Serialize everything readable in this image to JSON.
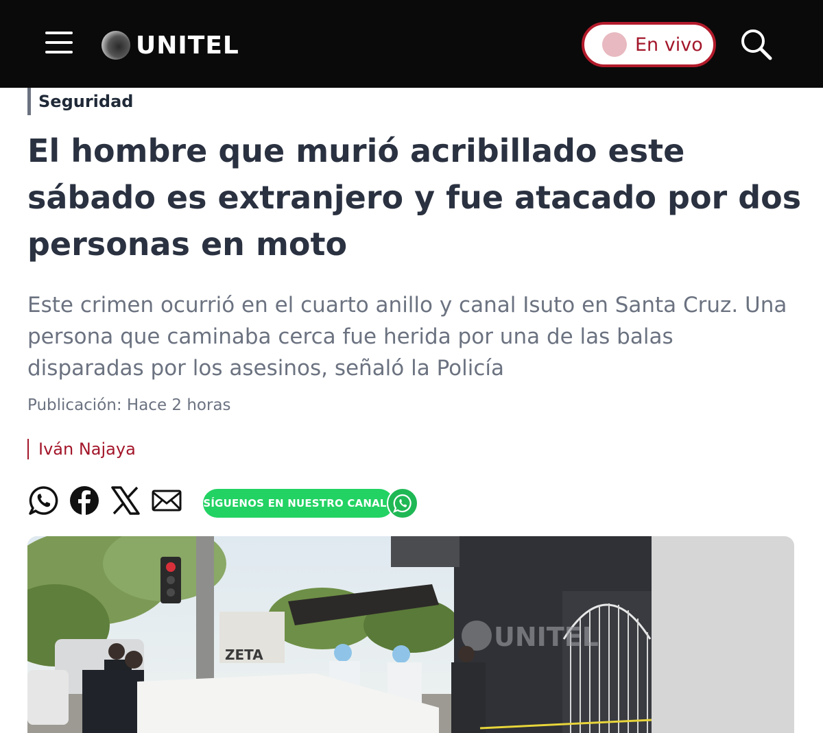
{
  "header": {
    "logo_text": "UNITEL",
    "live_label": "En vivo",
    "menu_icon": "hamburger-menu-icon",
    "search_icon": "search-icon",
    "colors": {
      "bar": "#0a0a0a",
      "accent": "#a3162a"
    }
  },
  "article": {
    "category": "Seguridad",
    "headline": "El hombre que murió acribillado este sábado es extranjero y fue atacado por dos personas en moto",
    "summary": "Este crimen ocurrió en el cuarto anillo y canal Isuto en Santa Cruz. Una persona que caminaba cerca fue herida por una de las balas disparadas por los asesinos, señaló la Policía",
    "published": "Publicación: Hace 2 horas",
    "author": "Iván Najaya"
  },
  "share": {
    "icons": [
      "whatsapp-icon",
      "facebook-icon",
      "x-icon",
      "email-icon"
    ],
    "channel_label": "SÍGUENOS EN NUESTRO CANAL",
    "channel_color": "#22d263"
  },
  "hero": {
    "image": "crime-scene-photo",
    "watermark": "UNITEL",
    "sign_text": "ZETA"
  }
}
